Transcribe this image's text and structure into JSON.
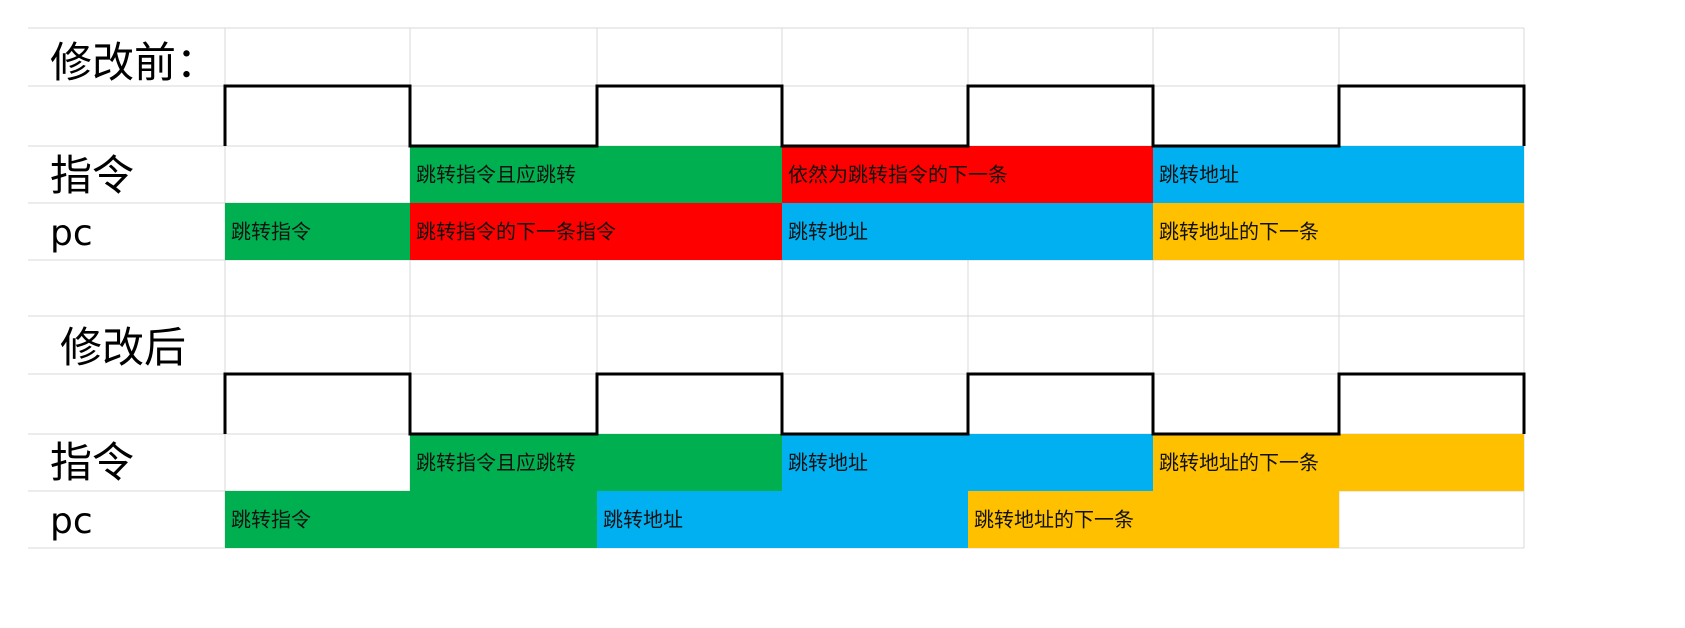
{
  "colors": {
    "green": "#00b050",
    "red": "#ff0000",
    "blue": "#00b0f0",
    "orange": "#ffc000",
    "grid": "#d9d9d9",
    "wave": "#000000"
  },
  "sections": [
    {
      "title": "修改前：",
      "instr_label": "指令",
      "pc_label": "pc",
      "instr_blocks": [
        {
          "text": "跳转指令且应跳转",
          "color": "green",
          "start": 1,
          "end": 3
        },
        {
          "text": "依然为跳转指令的下一条",
          "color": "red",
          "start": 3,
          "end": 5
        },
        {
          "text": "跳转地址",
          "color": "blue",
          "start": 5,
          "end": 7
        }
      ],
      "pc_blocks": [
        {
          "text": "跳转指令",
          "color": "green",
          "start": 0,
          "end": 1
        },
        {
          "text": "跳转指令的下一条指令",
          "color": "red",
          "start": 1,
          "end": 3
        },
        {
          "text": "跳转地址",
          "color": "blue",
          "start": 3,
          "end": 5
        },
        {
          "text": "跳转地址的下一条",
          "color": "orange",
          "start": 5,
          "end": 7
        }
      ]
    },
    {
      "title": "修改后",
      "instr_label": "指令",
      "pc_label": "pc",
      "instr_blocks": [
        {
          "text": "跳转指令且应跳转",
          "color": "green",
          "start": 1,
          "end": 3
        },
        {
          "text": "跳转地址",
          "color": "blue",
          "start": 3,
          "end": 5
        },
        {
          "text": "跳转地址的下一条",
          "color": "orange",
          "start": 5,
          "end": 7
        }
      ],
      "pc_blocks": [
        {
          "text": "跳转指令",
          "color": "green",
          "start": 0,
          "end": 2
        },
        {
          "text": "跳转地址",
          "color": "blue",
          "start": 2,
          "end": 4
        },
        {
          "text": "跳转地址的下一条",
          "color": "orange",
          "start": 4,
          "end": 6
        }
      ]
    }
  ]
}
